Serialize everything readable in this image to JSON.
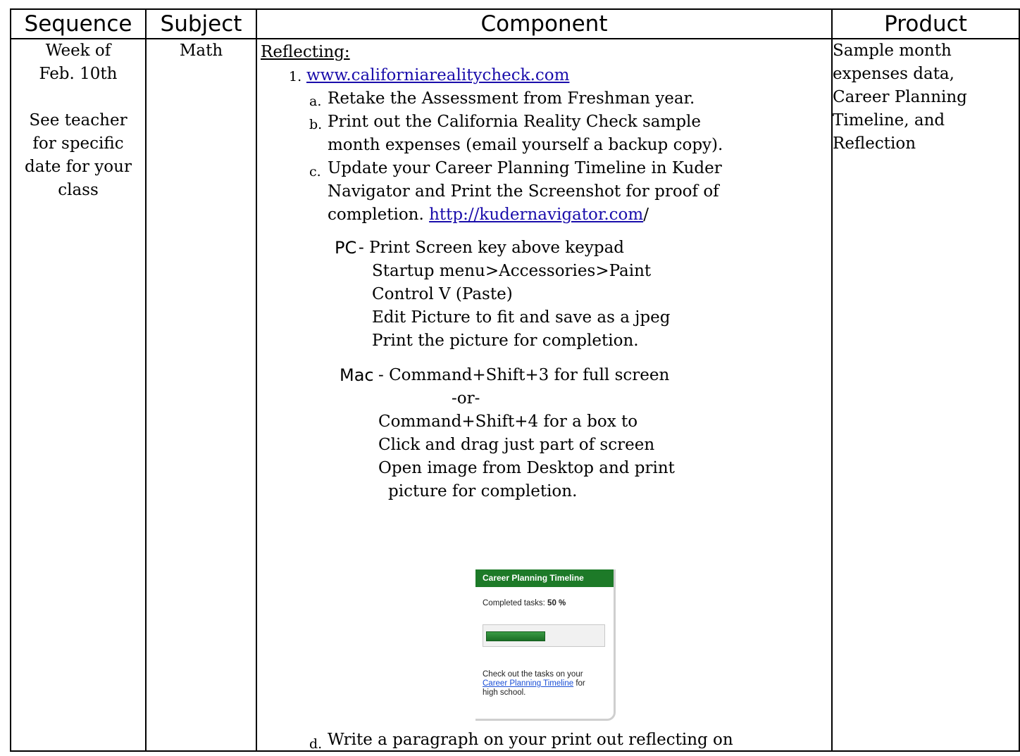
{
  "table": {
    "headers": [
      "Sequence",
      "Subject",
      "Component",
      "Product"
    ],
    "sequence": {
      "line1": "Week of",
      "line2": "Feb. 10th",
      "line3": "See teacher",
      "line4": "for specific",
      "line5": "date for your",
      "line6": "class"
    },
    "subject": "Math",
    "product": {
      "line1": "Sample month",
      "line2": "expenses data,",
      "line3": "Career Planning",
      "line4": "Timeline, and",
      "line5": "Reflection"
    }
  },
  "component": {
    "heading": "Reflecting:",
    "item1_number": "1.",
    "item1_link": "www.californiarealitycheck.com",
    "a_label": "a.",
    "a_text": "Retake the Assessment from Freshman year.",
    "b_label": "b.",
    "b_line1": "Print out the California Reality Check sample",
    "b_line2": "month expenses (email yourself a backup copy).",
    "c_label": "c.",
    "c_line1": "Update your Career Planning Timeline in Kuder",
    "c_line2": "Navigator and Print the Screenshot for proof of",
    "c_line3_prefix": "completion. ",
    "c_line3_link": "http://kudernavigator.com",
    "c_line3_suffix": "/",
    "pc_label": "PC",
    "pc_line1": "- Print Screen key above keypad",
    "pc_line2": "Startup menu>Accessories>Paint",
    "pc_line3": "Control V (Paste)",
    "pc_line4": "Edit Picture to fit and save as a jpeg",
    "pc_line5": "Print the picture for completion.",
    "mac_label": "Mac",
    "mac_line1": "- Command+Shift+3 for full screen",
    "mac_or": "-or-",
    "mac_line2": "Command+Shift+4 for a box to",
    "mac_line3": "Click and drag just part of screen",
    "mac_line4": "Open image from Desktop and print",
    "mac_line5": "picture for completion.",
    "d_label": "d.",
    "d_text": "Write a paragraph on your print out reflecting on"
  },
  "widget": {
    "title": "Career Planning Timeline",
    "completed_label": "Completed tasks: ",
    "completed_value": "50 %",
    "progress_fraction": 0.5,
    "accent_color": "#1d7a28",
    "text_line1": "Check out the tasks on your",
    "text_link": "Career Planning Timeline",
    "text_after_link": " for",
    "text_line3": "high school."
  }
}
